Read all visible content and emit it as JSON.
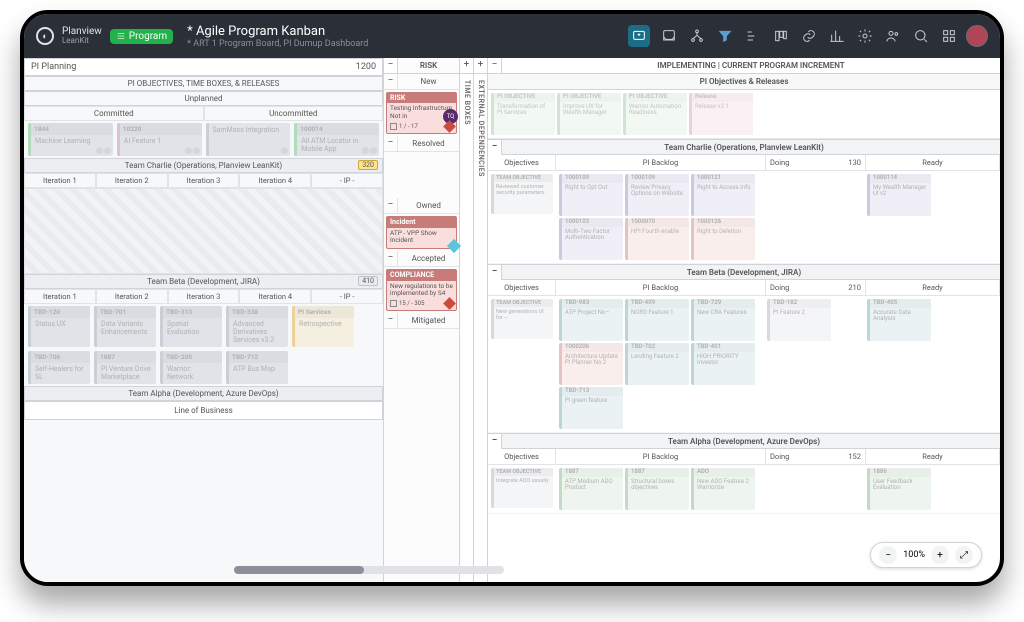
{
  "header": {
    "brand_line1": "Planview",
    "brand_line2": "LeanKit",
    "program_chip": "Program",
    "title": "* Agile Program Kanban",
    "subtitle": "* ART 1 Program Board, PI Dumup Dashboard"
  },
  "left": {
    "pi_planning": "PI Planning",
    "pi_planning_count": "1200",
    "sub1": "PI OBJECTIVES, TIME BOXES, & RELEASES",
    "unplanned": "Unplanned",
    "committed": "Committed",
    "uncommitted": "Uncommitted",
    "team_charlie": "Team Charlie (Operations, Planview LeanKit)",
    "charlie_count": "320",
    "iterations": [
      "Iteration 1",
      "Iteration 2",
      "Iteration 3",
      "Iteration 4",
      "- IP -"
    ],
    "team_beta": "Team Beta (Development, JIRA)",
    "beta_count": "410",
    "team_alpha": "Team Alpha (Development, Azure DevOps)",
    "lob": "Line of Business",
    "top_cards": [
      {
        "h": "1844",
        "t": "Machine Learning"
      },
      {
        "h": "10220",
        "t": "AI Feature 1"
      },
      {
        "h": "",
        "t": "SamMass Integration"
      },
      {
        "h": "100014",
        "t": "All ATM Locator in Mobile App"
      }
    ],
    "beta_cards": [
      {
        "h": "TBD-120",
        "t": "Status UX"
      },
      {
        "h": "TBD-701",
        "t": "Data Variants Enhancements"
      },
      {
        "h": "TBD-313",
        "t": "Spatial Evaluation"
      },
      {
        "h": "TBD-338",
        "t": "Advanced Derivatives Services v3.2"
      },
      {
        "h": "PI Services",
        "t": "Retrospective"
      },
      {
        "h": "TBD-706",
        "t": "Self-Healers for SL"
      },
      {
        "h": "1887",
        "t": "PI Venture Drive Marketplace"
      },
      {
        "h": "TBD-205",
        "t": "Warrior: Network"
      },
      {
        "h": "TBD-712",
        "t": "ATP Bus Map"
      }
    ]
  },
  "risk_col": {
    "header": "RISK",
    "new": "New",
    "resolved": "Resolved",
    "owned": "Owned",
    "accepted": "Accepted",
    "mitigated": "Mitigated",
    "risk_card": {
      "head": "RISK",
      "body": "Testing Infrastructure Not in",
      "check": "1 / - 17",
      "tag": "TQ"
    },
    "incident_card": {
      "head": "Incident",
      "body": "ATP - VPP Show Incident"
    },
    "compliance_card": {
      "head": "COMPLIANCE",
      "body": "New regulations to be implemented by S4",
      "check": "15 / - 305"
    }
  },
  "vert_labels": {
    "time": "TIME BOXES",
    "ext": "EXTERNAL DEPENDENCIES"
  },
  "right": {
    "implementing": "IMPLEMENTING | CURRENT PROGRAM INCREMENT",
    "pi_objectives": "PI Objectives & Releases",
    "top_cards": [
      {
        "cls": "c-green",
        "h": "PI OBJECTIVE",
        "t": "Transformation of PI Services"
      },
      {
        "cls": "c-green",
        "h": "PI OBJECTIVE",
        "t": "Improve UX for Wealth Manager"
      },
      {
        "cls": "c-green",
        "h": "PI OBJECTIVE",
        "t": "Warrior Automation Readiness"
      },
      {
        "cls": "c-pink",
        "h": "Release",
        "t": "Release v2.1"
      }
    ],
    "team_charlie": "Team Charlie (Operations, Planview LeanKit)",
    "doing_count_c": "130",
    "team_beta": "Team Beta (Development, JIRA)",
    "doing_count_b": "210",
    "team_alpha": "Team Alpha (Development, Azure DevOps)",
    "doing_count_a": "152",
    "col_labels": {
      "obj": "Objectives",
      "backlog": "PI Backlog",
      "doing": "Doing",
      "ready": "Ready"
    },
    "charlie": {
      "obj": {
        "h": "TEAM OBJECTIVE",
        "t": "Reviewed customer security parameters"
      },
      "backlog": [
        {
          "cls": "c-lav",
          "h": "1000109",
          "t": "Right to Opt Out"
        },
        {
          "cls": "c-lav",
          "h": "1000109",
          "t": "Review Privacy Options on Website"
        },
        {
          "cls": "c-lav",
          "h": "1000121",
          "t": "Right to Access Info"
        },
        {
          "cls": "c-lav",
          "h": "1000103",
          "t": "Multi-Two Factor Authentication"
        },
        {
          "cls": "c-red",
          "h": "1000070",
          "t": "HPI Fourth enable"
        },
        {
          "cls": "c-red",
          "h": "1000126",
          "t": "Right to Deletion"
        }
      ],
      "ready": {
        "cls": "c-lav",
        "h": "1000114",
        "t": "My Wealth Manager UI v2"
      }
    },
    "beta": {
      "obj": {
        "h": "TEAM OBJECTIVE",
        "t": "New generations UI for –"
      },
      "backlog": [
        {
          "cls": "c-teal",
          "h": "TBD-983",
          "t": "ATP Project No–"
        },
        {
          "cls": "c-teal",
          "h": "TBD-409",
          "t": "NORD Feature 1"
        },
        {
          "cls": "c-teal",
          "h": "TBD-729",
          "t": "New CRA Features"
        },
        {
          "cls": "c-red",
          "h": "1000206",
          "t": "Architecture Update PI Planner No 2"
        },
        {
          "cls": "c-teal",
          "h": "TBD-702",
          "t": "Lending Feature 2"
        },
        {
          "cls": "c-teal",
          "h": "TBD-401",
          "t": "HIGH PRIORITY Investor"
        },
        {
          "cls": "c-teal",
          "h": "TBD-713",
          "t": "PI green feature"
        }
      ],
      "doing": [
        {
          "cls": "c-gray",
          "h": "TBD-182",
          "t": "PI Feature 2"
        }
      ],
      "ready": {
        "cls": "c-teal",
        "h": "TBD-405",
        "t": "Accurate Data Analysis"
      }
    },
    "alpha": {
      "obj": {
        "h": "TEAM OBJECTIVE",
        "t": "Integrate ADO usually"
      },
      "backlog": [
        {
          "cls": "c-green",
          "h": "1887",
          "t": "ATP Medium ADO Product"
        },
        {
          "cls": "c-green",
          "h": "1887",
          "t": "Structural boxes objectives"
        },
        {
          "cls": "c-green",
          "h": "ADO",
          "t": "New ADO Feature 2 Warriorize"
        }
      ],
      "ready": {
        "cls": "c-green",
        "h": "1886",
        "t": "User Feedback Evaluation"
      }
    }
  },
  "zoom": "100%"
}
